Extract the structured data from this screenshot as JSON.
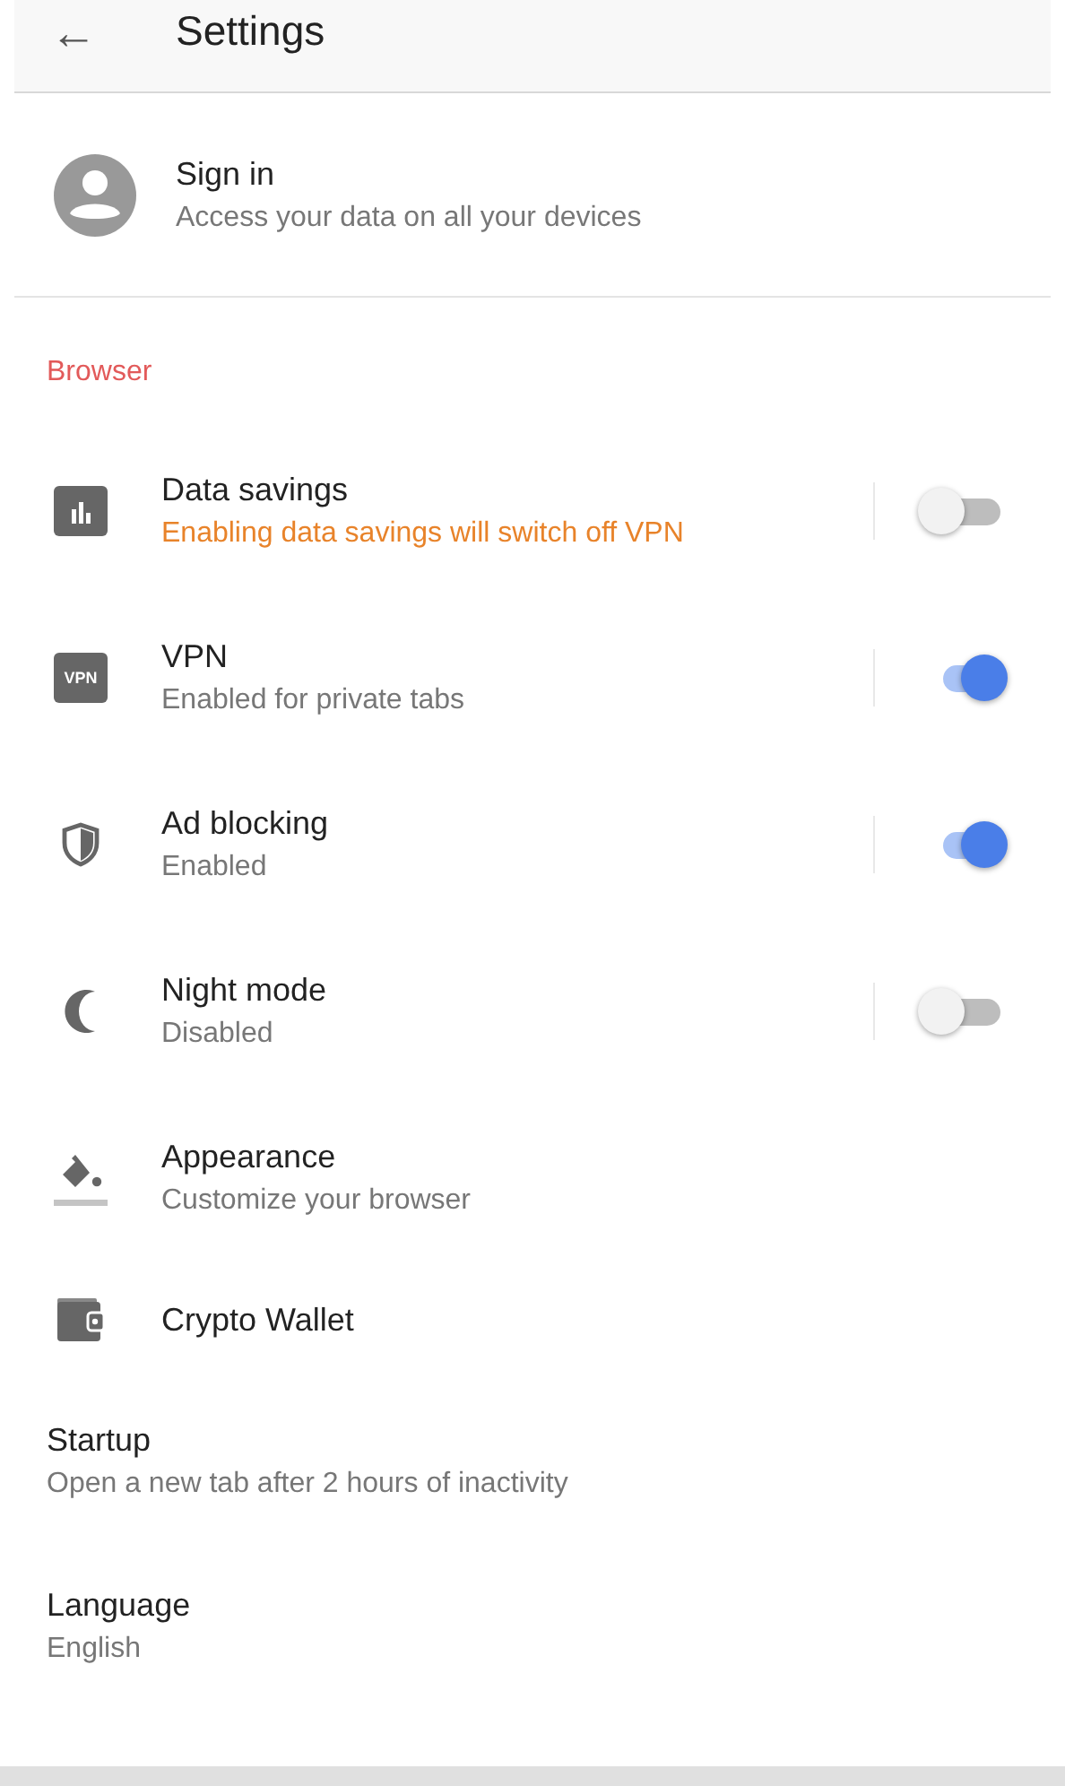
{
  "header": {
    "back": "←",
    "title": "Settings"
  },
  "account": {
    "title": "Sign in",
    "subtitle": "Access your data on all your devices"
  },
  "section": {
    "title": "Browser"
  },
  "items": [
    {
      "kind": "toggle",
      "title": "Data savings",
      "warning": "Enabling data savings will switch off VPN",
      "on": false
    },
    {
      "kind": "toggle",
      "icon_text": "VPN",
      "title": "VPN",
      "subtitle": "Enabled for private tabs",
      "on": true
    },
    {
      "kind": "toggle",
      "title": "Ad blocking",
      "subtitle": "Enabled",
      "on": true
    },
    {
      "kind": "toggle",
      "title": "Night mode",
      "subtitle": "Disabled",
      "on": false
    },
    {
      "kind": "link",
      "title": "Appearance",
      "subtitle": "Customize your browser"
    },
    {
      "kind": "link",
      "title": "Crypto Wallet"
    },
    {
      "kind": "plain",
      "title": "Startup",
      "subtitle": "Open a new tab after 2 hours of inactivity"
    },
    {
      "kind": "plain",
      "title": "Language",
      "subtitle": "English"
    }
  ]
}
